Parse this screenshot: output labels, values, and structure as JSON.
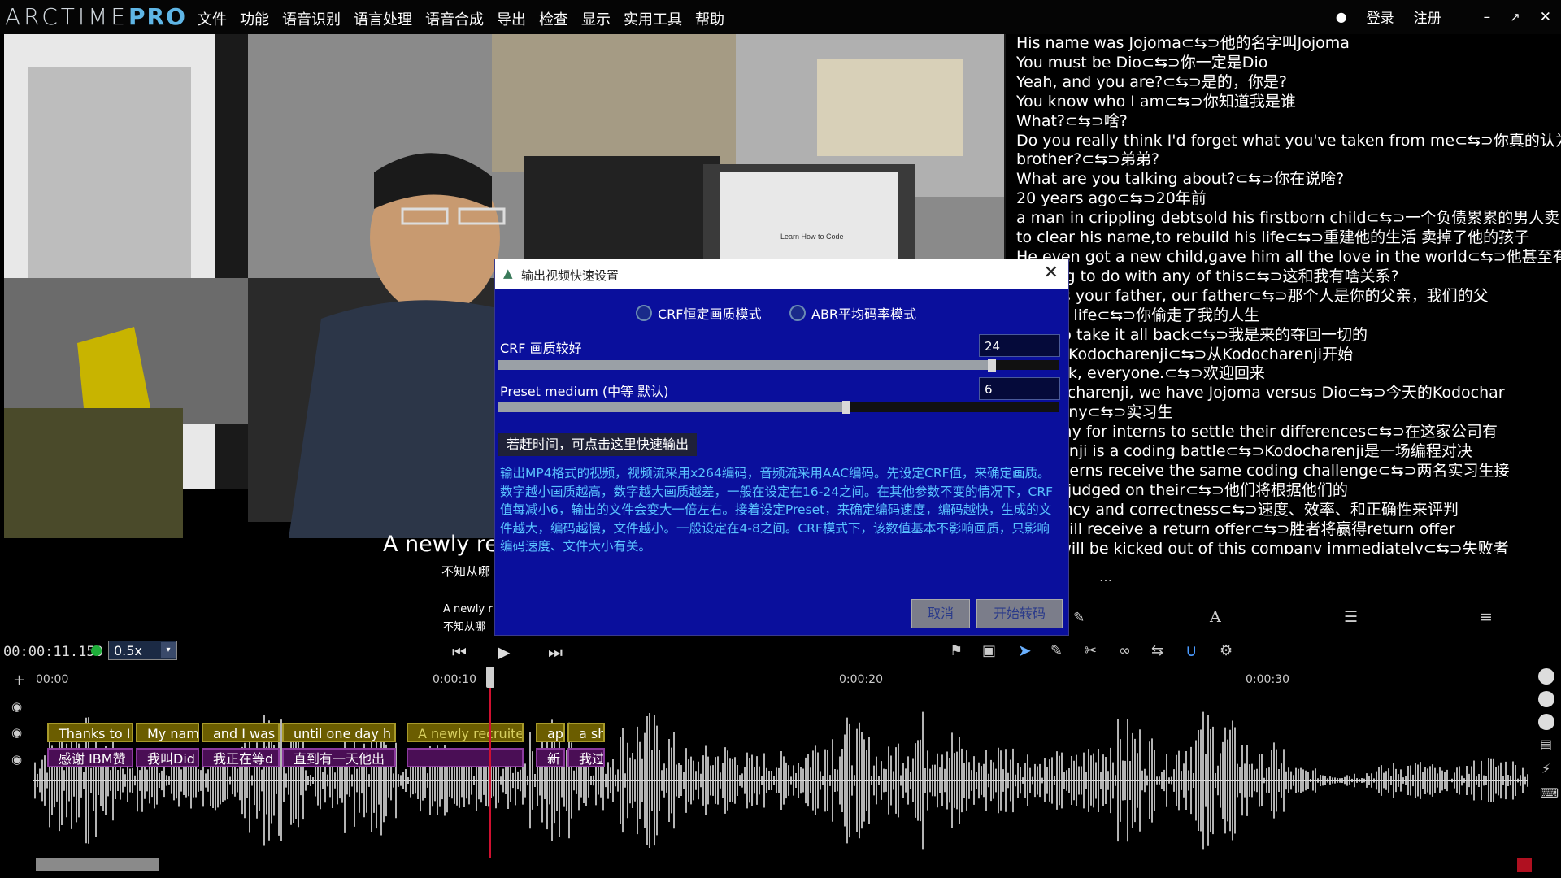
{
  "app": {
    "logo_main": "ARCTIME",
    "logo_pro": "PRO",
    "menu": [
      "文件",
      "功能",
      "语音识别",
      "语言处理",
      "语音合成",
      "导出",
      "检查",
      "显示",
      "实用工具",
      "帮助"
    ],
    "login": "登录",
    "logout": "注册"
  },
  "video": {
    "overlay_line1": "A newly rec",
    "overlay_line2": "不知从哪",
    "small_line1": "A newly r",
    "small_line2": "不知从哪",
    "screen_text": "Learn How to Code"
  },
  "subtitle_list": [
    "His name was Jojoma⊂⇆⊃他的名字叫Jojoma",
    "You must be Dio⊂⇆⊃你一定是Dio",
    "Yeah, and you are?⊂⇆⊃是的，你是?",
    "You know who I am⊂⇆⊃你知道我是谁",
    "What?⊂⇆⊃啥?",
    "Do you really think I'd forget what you've taken from me⊂⇆⊃你真的认为",
    "brother?⊂⇆⊃弟弟?",
    "What are you talking about?⊂⇆⊃你在说啥?",
    "20 years ago⊂⇆⊃20年前",
    "a man in crippling debtsold his firstborn child⊂⇆⊃一个负债累累的男人卖",
    "to clear his name,to rebuild his life⊂⇆⊃重建他的生活 卖掉了他的孩子",
    "He even got a new child,gave him all the love in the world⊂⇆⊃他甚至有",
    "nothing to do with any of this⊂⇆⊃这和我有啥关系?",
    "an was your father, our father⊂⇆⊃那个人是你的父亲，我们的父",
    "ole my life⊂⇆⊃你偷走了我的人生",
    " here to take it all back⊂⇆⊃我是来的夺回一切的",
    " with a Kodocharenji⊂⇆⊃从Kodocharenji开始",
    "ne back, everyone.⊂⇆⊃欢迎回来",
    "s Kodocharenji, we have Jojoma versus Dio⊂⇆⊃今天的Kodochar",
    "company⊂⇆⊃实习生",
    " one way for interns to settle their differences⊂⇆⊃在这家公司有",
    "ocharenji is a coding battle⊂⇆⊃Kodocharenji是一场编程对决",
    "two interns receive the same coding challenge⊂⇆⊃两名实习生接",
    "vill be judged on their⊂⇆⊃他们将根据他们的",
    " efficiency and correctness⊂⇆⊃速度、效率、和正确性来评判",
    "nner will receive a return offer⊂⇆⊃胜者将赢得return offer",
    "loser will be kicked out of this company immediately⊂⇆⊃失败者"
  ],
  "player": {
    "timecode": "00:00:11.150",
    "speed": "0.5x"
  },
  "ruler": [
    "00:00",
    "0:00:10",
    "0:00:20",
    "0:00:30"
  ],
  "tracks": {
    "en": [
      "Thanks to I",
      "My nam",
      "and I was",
      "until one day h",
      "A newly recruite",
      "ap",
      "a sh"
    ],
    "zh": [
      "感谢 IBM赞",
      "我叫Did",
      "我正在等d",
      "直到有一天他出",
      "",
      "新",
      "我过"
    ]
  },
  "dialog": {
    "title": "输出视频快速设置",
    "mode_crf": "CRF恒定画质模式",
    "mode_abr": "ABR平均码率模式",
    "crf_label": "CRF 画质较好",
    "crf_value": "24",
    "crf_fill": 0.88,
    "preset_label": "Preset medium (中等 默认)",
    "preset_value": "6",
    "preset_fill": 0.62,
    "quick_hint": "若赶时间，可点击这里快速输出",
    "description": "输出MP4格式的视频，视频流采用x264编码，音频流采用AAC编码。先设定CRF值，来确定画质。数字越小画质越高，数字越大画质越差，一般在设定在16-24之间。在其他参数不变的情况下，CRF值每减小6，输出的文件会变大一倍左右。接着设定Preset，来确定编码速度，编码越快，生成的文件越大，编码越慢，文件越小。一般设定在4-8之间。CRF模式下，该数值基本不影响画质，只影响编码速度、文件大小有关。",
    "cancel": "取消",
    "start": "开始转码"
  },
  "colors": {
    "dialog_bg": "#0a0f9c",
    "en_segment": "#6b5d00",
    "zh_segment": "#4a0e55",
    "waveform": "#b4b4b4",
    "playhead": "#d01030"
  }
}
